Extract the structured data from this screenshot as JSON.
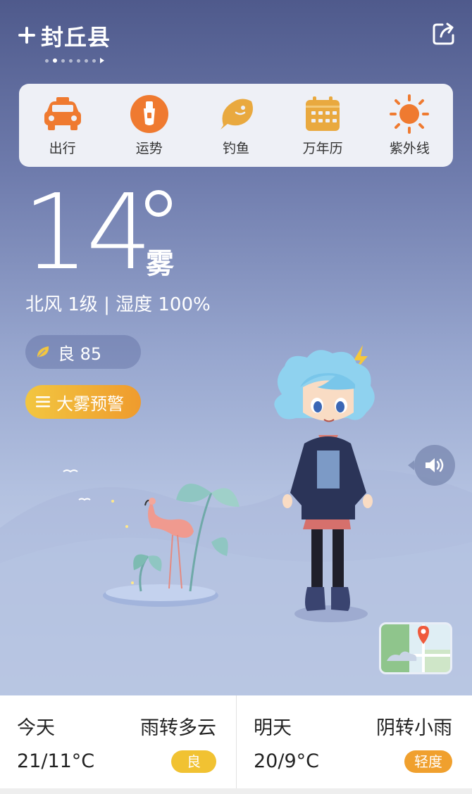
{
  "header": {
    "city": "封丘县",
    "page_dots": 7,
    "active_dot": 1
  },
  "tools": [
    {
      "label": "出行",
      "icon": "car-icon"
    },
    {
      "label": "运势",
      "icon": "fortune-icon"
    },
    {
      "label": "钓鱼",
      "icon": "fish-icon"
    },
    {
      "label": "万年历",
      "icon": "calendar-icon"
    },
    {
      "label": "紫外线",
      "icon": "sun-icon"
    }
  ],
  "current": {
    "temp": "14",
    "condition": "雾",
    "wind_humidity": "北风 1级 | 湿度 100%"
  },
  "aqi": {
    "text": "良 85"
  },
  "warning": {
    "text": "大雾预警"
  },
  "forecast": {
    "today": {
      "day": "今天",
      "condition": "雨转多云",
      "temp": "21/11°C",
      "aqi": "良",
      "aqi_color": "#f1c232"
    },
    "tomorrow": {
      "day": "明天",
      "condition": "阴转小雨",
      "temp": "20/9°C",
      "aqi": "轻度",
      "aqi_color": "#f0a02e"
    }
  },
  "colors": {
    "tool_orange": "#ef7a30",
    "tool_gold": "#e9a93f"
  }
}
